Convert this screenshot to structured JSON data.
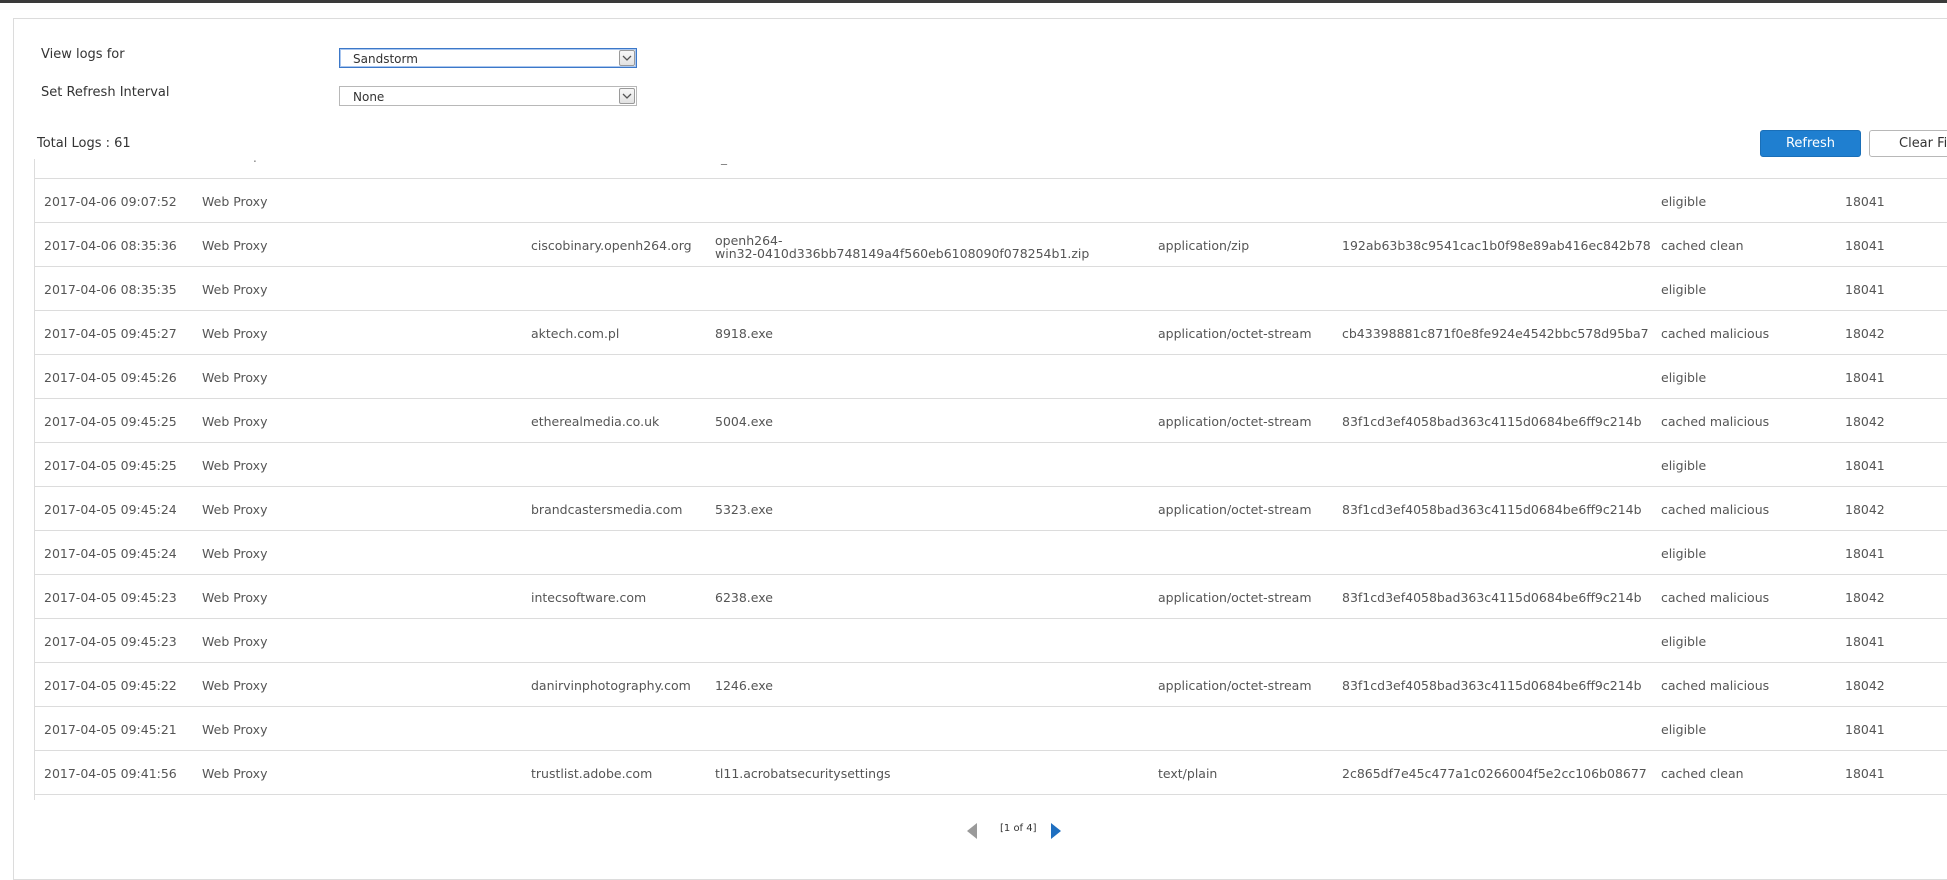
{
  "filters": {
    "view_logs_label": "View logs for",
    "view_logs_value": "Sandstorm",
    "refresh_interval_label": "Set Refresh Interval",
    "refresh_interval_value": "None"
  },
  "toolbar": {
    "total_logs": "Total Logs : 61",
    "refresh_label": "Refresh",
    "clear_label": "Clear Filter"
  },
  "colors": {
    "accent": "#1f7fd0",
    "border": "#dcdcdc",
    "pager_next": "#1f6fc0",
    "pager_prev": "#9a9a9a"
  },
  "rows": [
    {
      "time": "2017-04-06 09:07:52",
      "module": "Web Proxy",
      "domain": "",
      "file": "",
      "type": "",
      "hash": "",
      "status": "eligible",
      "id": "18041"
    },
    {
      "time": "2017-04-06 08:35:36",
      "module": "Web Proxy",
      "domain": "ciscobinary.openh264.org",
      "file": "openh264-",
      "file2": "win32-0410d336bb748149a4f560eb6108090f078254b1.zip",
      "type": "application/zip",
      "hash": "192ab63b38c9541cac1b0f98e89ab416ec842b78",
      "status": "cached clean",
      "id": "18041"
    },
    {
      "time": "2017-04-06 08:35:35",
      "module": "Web Proxy",
      "domain": "",
      "file": "",
      "type": "",
      "hash": "",
      "status": "eligible",
      "id": "18041"
    },
    {
      "time": "2017-04-05 09:45:27",
      "module": "Web Proxy",
      "domain": "aktech.com.pl",
      "file": "8918.exe",
      "type": "application/octet-stream",
      "hash": "cb43398881c871f0e8fe924e4542bbc578d95ba7",
      "status": "cached malicious",
      "id": "18042"
    },
    {
      "time": "2017-04-05 09:45:26",
      "module": "Web Proxy",
      "domain": "",
      "file": "",
      "type": "",
      "hash": "",
      "status": "eligible",
      "id": "18041"
    },
    {
      "time": "2017-04-05 09:45:25",
      "module": "Web Proxy",
      "domain": "etherealmedia.co.uk",
      "file": "5004.exe",
      "type": "application/octet-stream",
      "hash": "83f1cd3ef4058bad363c4115d0684be6ff9c214b",
      "status": "cached malicious",
      "id": "18042"
    },
    {
      "time": "2017-04-05 09:45:25",
      "module": "Web Proxy",
      "domain": "",
      "file": "",
      "type": "",
      "hash": "",
      "status": "eligible",
      "id": "18041"
    },
    {
      "time": "2017-04-05 09:45:24",
      "module": "Web Proxy",
      "domain": "brandcastersmedia.com",
      "file": "5323.exe",
      "type": "application/octet-stream",
      "hash": "83f1cd3ef4058bad363c4115d0684be6ff9c214b",
      "status": "cached malicious",
      "id": "18042"
    },
    {
      "time": "2017-04-05 09:45:24",
      "module": "Web Proxy",
      "domain": "",
      "file": "",
      "type": "",
      "hash": "",
      "status": "eligible",
      "id": "18041"
    },
    {
      "time": "2017-04-05 09:45:23",
      "module": "Web Proxy",
      "domain": "intecsoftware.com",
      "file": "6238.exe",
      "type": "application/octet-stream",
      "hash": "83f1cd3ef4058bad363c4115d0684be6ff9c214b",
      "status": "cached malicious",
      "id": "18042"
    },
    {
      "time": "2017-04-05 09:45:23",
      "module": "Web Proxy",
      "domain": "",
      "file": "",
      "type": "",
      "hash": "",
      "status": "eligible",
      "id": "18041"
    },
    {
      "time": "2017-04-05 09:45:22",
      "module": "Web Proxy",
      "domain": "danirvinphotography.com",
      "file": "1246.exe",
      "type": "application/octet-stream",
      "hash": "83f1cd3ef4058bad363c4115d0684be6ff9c214b",
      "status": "cached malicious",
      "id": "18042"
    },
    {
      "time": "2017-04-05 09:45:21",
      "module": "Web Proxy",
      "domain": "",
      "file": "",
      "type": "",
      "hash": "",
      "status": "eligible",
      "id": "18041"
    },
    {
      "time": "2017-04-05 09:41:56",
      "module": "Web Proxy",
      "domain": "trustlist.adobe.com",
      "file": "tl11.acrobatsecuritysettings",
      "type": "text/plain",
      "hash": "2c865df7e45c477a1c0266004f5e2cc106b08677",
      "status": "cached clean",
      "id": "18041"
    }
  ],
  "pager": {
    "text": "[1 of 4]",
    "prev_icon": "prev-page-icon",
    "next_icon": "next-page-icon"
  }
}
